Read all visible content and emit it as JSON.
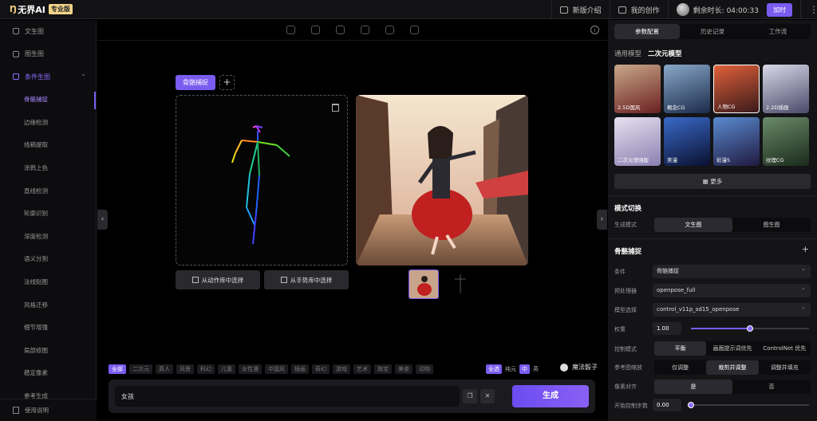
{
  "topbar": {
    "logo_mark": "Ŋ",
    "logo_text": "无界AI",
    "badge": "专业版",
    "new_intro": "新版介绍",
    "my_creation": "我的创作",
    "remaining": "剩余时长: 04:00:33",
    "join": "加时",
    "more": "⋮"
  },
  "sidebar": {
    "items": [
      {
        "label": "文生图"
      },
      {
        "label": "图生图"
      },
      {
        "label": "条件生图"
      }
    ],
    "sub_items": [
      "骨骼捕捉",
      "边缘检测",
      "线稿提取",
      "涂鸦上色",
      "直线检测",
      "轮廓识别",
      "深度检测",
      "语义分割",
      "法线贴图",
      "风格迁移",
      "细节增强",
      "局部修图",
      "稳定像素",
      "参考生成"
    ],
    "chevron": "⌃",
    "bottom": "使用说明"
  },
  "main": {
    "tab_label": "骨骼捕捉",
    "tab_add": "+",
    "btn_action_lib": "从动作库中选择",
    "btn_gesture_lib": "从手势库中选择",
    "collapse_left": "‹",
    "collapse_right": "›",
    "info": "i",
    "tags": [
      "全部",
      "二次元",
      "真人",
      "风景",
      "科幻",
      "儿童",
      "女性漫",
      "中国风",
      "插画",
      "奇幻",
      "游戏",
      "艺术",
      "珠宝",
      "美食",
      "动物"
    ],
    "tag_right": [
      "全选",
      "纯元",
      "中",
      "英"
    ],
    "magic": "魔法骰子",
    "prompt": "女孩",
    "copy_icon": "❐",
    "clear_icon": "✕",
    "generate": "生成"
  },
  "panel": {
    "tabs": [
      "参数配置",
      "历史记录",
      "工作流"
    ],
    "model_label": "通用模型",
    "model_value": "二次元模型",
    "models": [
      {
        "label": "2.5D国风",
        "c1": "#c9a88a",
        "c2": "#6a2020"
      },
      {
        "label": "概念CG",
        "c1": "#8aa8c9",
        "c2": "#1a2a4a"
      },
      {
        "label": "人物CG",
        "c1": "#e0603a",
        "c2": "#3a1a1a"
      },
      {
        "label": "2.2D插画",
        "c1": "#d8d8e8",
        "c2": "#4a4a6a"
      },
      {
        "label": "二次元增强版",
        "c1": "#e8e0f0",
        "c2": "#8a80b0"
      },
      {
        "label": "美漫",
        "c1": "#3a6ac9",
        "c2": "#0a1030"
      },
      {
        "label": "彩漫5",
        "c1": "#5a8ad0",
        "c2": "#201a40"
      },
      {
        "label": "纹理CG",
        "c1": "#6a8a6a",
        "c2": "#1a2a1a"
      }
    ],
    "more_models": "更多",
    "mode_title": "模式切换",
    "gen_mode_label": "生成模式",
    "gen_modes": [
      "文生图",
      "图生图"
    ],
    "pose_title": "骨骼捕捉",
    "pose_add": "+",
    "cond_label": "条件",
    "cond_value": "骨骼捕捉",
    "pre_label": "预处理器",
    "pre_value": "openpose_full",
    "model_sel_label": "模型选择",
    "model_sel_value": "control_v11p_sd15_openpose",
    "weight_label": "权重",
    "weight_value": "1.00",
    "weight_fraction": 0.5,
    "ctrl_label": "控制模式",
    "ctrl_modes": [
      "平衡",
      "画面提示词优先",
      "ControlNet 优先"
    ],
    "ref_label": "参考图缩放",
    "ref_modes": [
      "仅调整",
      "裁剪并调整",
      "调整并填充"
    ],
    "pixel_label": "像素对齐",
    "pixel_modes": [
      "是",
      "否"
    ],
    "start_label": "开始控制步数",
    "start_value": "0.00",
    "start_fraction": 0.0
  }
}
